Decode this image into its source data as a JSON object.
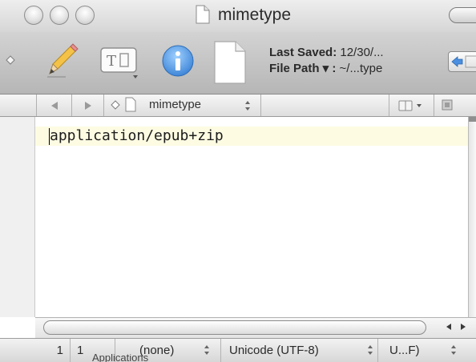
{
  "window": {
    "title": "mimetype"
  },
  "toolbar": {
    "saved_label": "Last Saved:",
    "saved_value": "12/30/...",
    "path_label": "File Path ▾ :",
    "path_value": "~/...type"
  },
  "navbar": {
    "file_name": "mimetype"
  },
  "editor": {
    "content": "application/epub+zip"
  },
  "statusbar": {
    "line": "1",
    "column": "1",
    "syntax": "(none)",
    "encoding": "Unicode (UTF-8)",
    "line_endings": "U...F)"
  },
  "background_window": {
    "partial_label": "Applications"
  },
  "icons": [
    "pencil-icon",
    "text-selection-icon",
    "info-icon",
    "document-icon",
    "diamond-icon"
  ],
  "colors": {
    "current_line": "#fdfbe2",
    "info_blue": "#3f86d8",
    "pencil_yellow": "#f3c247"
  }
}
